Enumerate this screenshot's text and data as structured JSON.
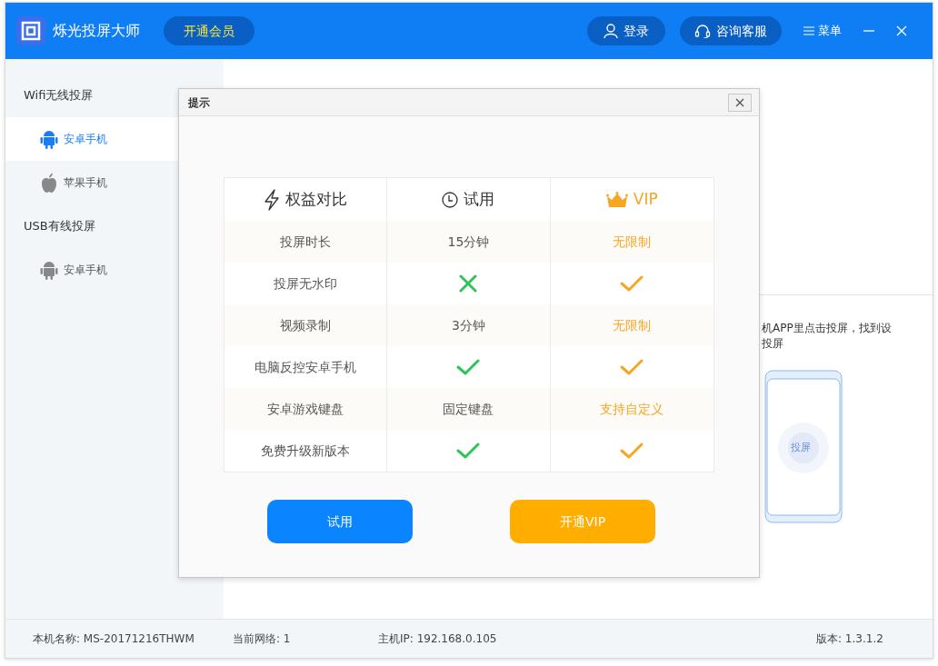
{
  "window": {
    "title": "烁光投屏大师"
  },
  "header": {
    "vip_button": "开通会员",
    "login_button": "登录",
    "service_button": "咨询客服",
    "menu_button": "菜单"
  },
  "sidebar": {
    "sections": [
      {
        "title": "Wifi无线投屏",
        "items": [
          {
            "label": "安卓手机",
            "kind": "android",
            "selected": true
          },
          {
            "label": "苹果手机",
            "kind": "apple",
            "selected": false
          }
        ]
      },
      {
        "title": "USB有线投屏",
        "items": [
          {
            "label": "安卓手机",
            "kind": "android",
            "selected": false
          }
        ]
      }
    ]
  },
  "content": {
    "instruction_lines": [
      "机APP里点击投屏，找到设",
      "投屏"
    ],
    "phone_button": "投屏"
  },
  "dialog": {
    "title": "提示",
    "table": {
      "columns": [
        {
          "label": "权益对比",
          "kind": "benefit"
        },
        {
          "label": "试用",
          "kind": "trial"
        },
        {
          "label": "VIP",
          "kind": "vip"
        }
      ],
      "rows": [
        {
          "feature": "投屏时长",
          "trial": {
            "kind": "text",
            "text": "15分钟"
          },
          "vip": {
            "kind": "text",
            "text": "无限制"
          }
        },
        {
          "feature": "投屏无水印",
          "trial": {
            "kind": "cross"
          },
          "vip": {
            "kind": "check"
          }
        },
        {
          "feature": "视频录制",
          "trial": {
            "kind": "text",
            "text": "3分钟"
          },
          "vip": {
            "kind": "text",
            "text": "无限制"
          }
        },
        {
          "feature": "电脑反控安卓手机",
          "trial": {
            "kind": "check"
          },
          "vip": {
            "kind": "check"
          }
        },
        {
          "feature": "安卓游戏键盘",
          "trial": {
            "kind": "text",
            "text": "固定键盘"
          },
          "vip": {
            "kind": "text",
            "text": "支持自定义"
          }
        },
        {
          "feature": "免费升级新版本",
          "trial": {
            "kind": "check"
          },
          "vip": {
            "kind": "check"
          }
        }
      ]
    },
    "buttons": [
      {
        "label": "试用",
        "kind": "primary"
      },
      {
        "label": "开通VIP",
        "kind": "vip"
      }
    ]
  },
  "status_bar": {
    "items": [
      "本机名称: MS-20171216THWM",
      "当前网络: 1",
      "主机IP: 192.168.0.105",
      "版本: 1.3.1.2"
    ]
  }
}
